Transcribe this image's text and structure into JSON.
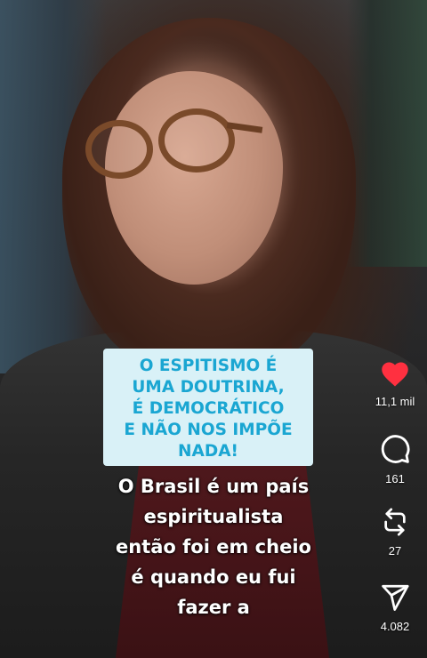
{
  "overlay": {
    "caption_lines": [
      "O ESPITISMO É",
      "UMA DOUTRINA,",
      "É DEMOCRÁTICO",
      "E NÃO NOS IMPÕE",
      "NADA!"
    ],
    "subtitle_lines": [
      "O Brasil é um país",
      "espiritualista",
      "então foi em cheio",
      "é quando eu fui",
      "fazer a"
    ]
  },
  "actions": {
    "like": {
      "icon": "heart-icon",
      "count": "11,1 mil",
      "liked": true,
      "color": "#ff3040"
    },
    "comment": {
      "icon": "comment-icon",
      "count": "161"
    },
    "repost": {
      "icon": "repost-icon",
      "count": "27"
    },
    "share": {
      "icon": "send-icon",
      "count": "4.082"
    }
  },
  "colors": {
    "caption_background": "#d9f1f7",
    "caption_text": "#1aa6d2",
    "subtitle_text": "#ffffff"
  }
}
